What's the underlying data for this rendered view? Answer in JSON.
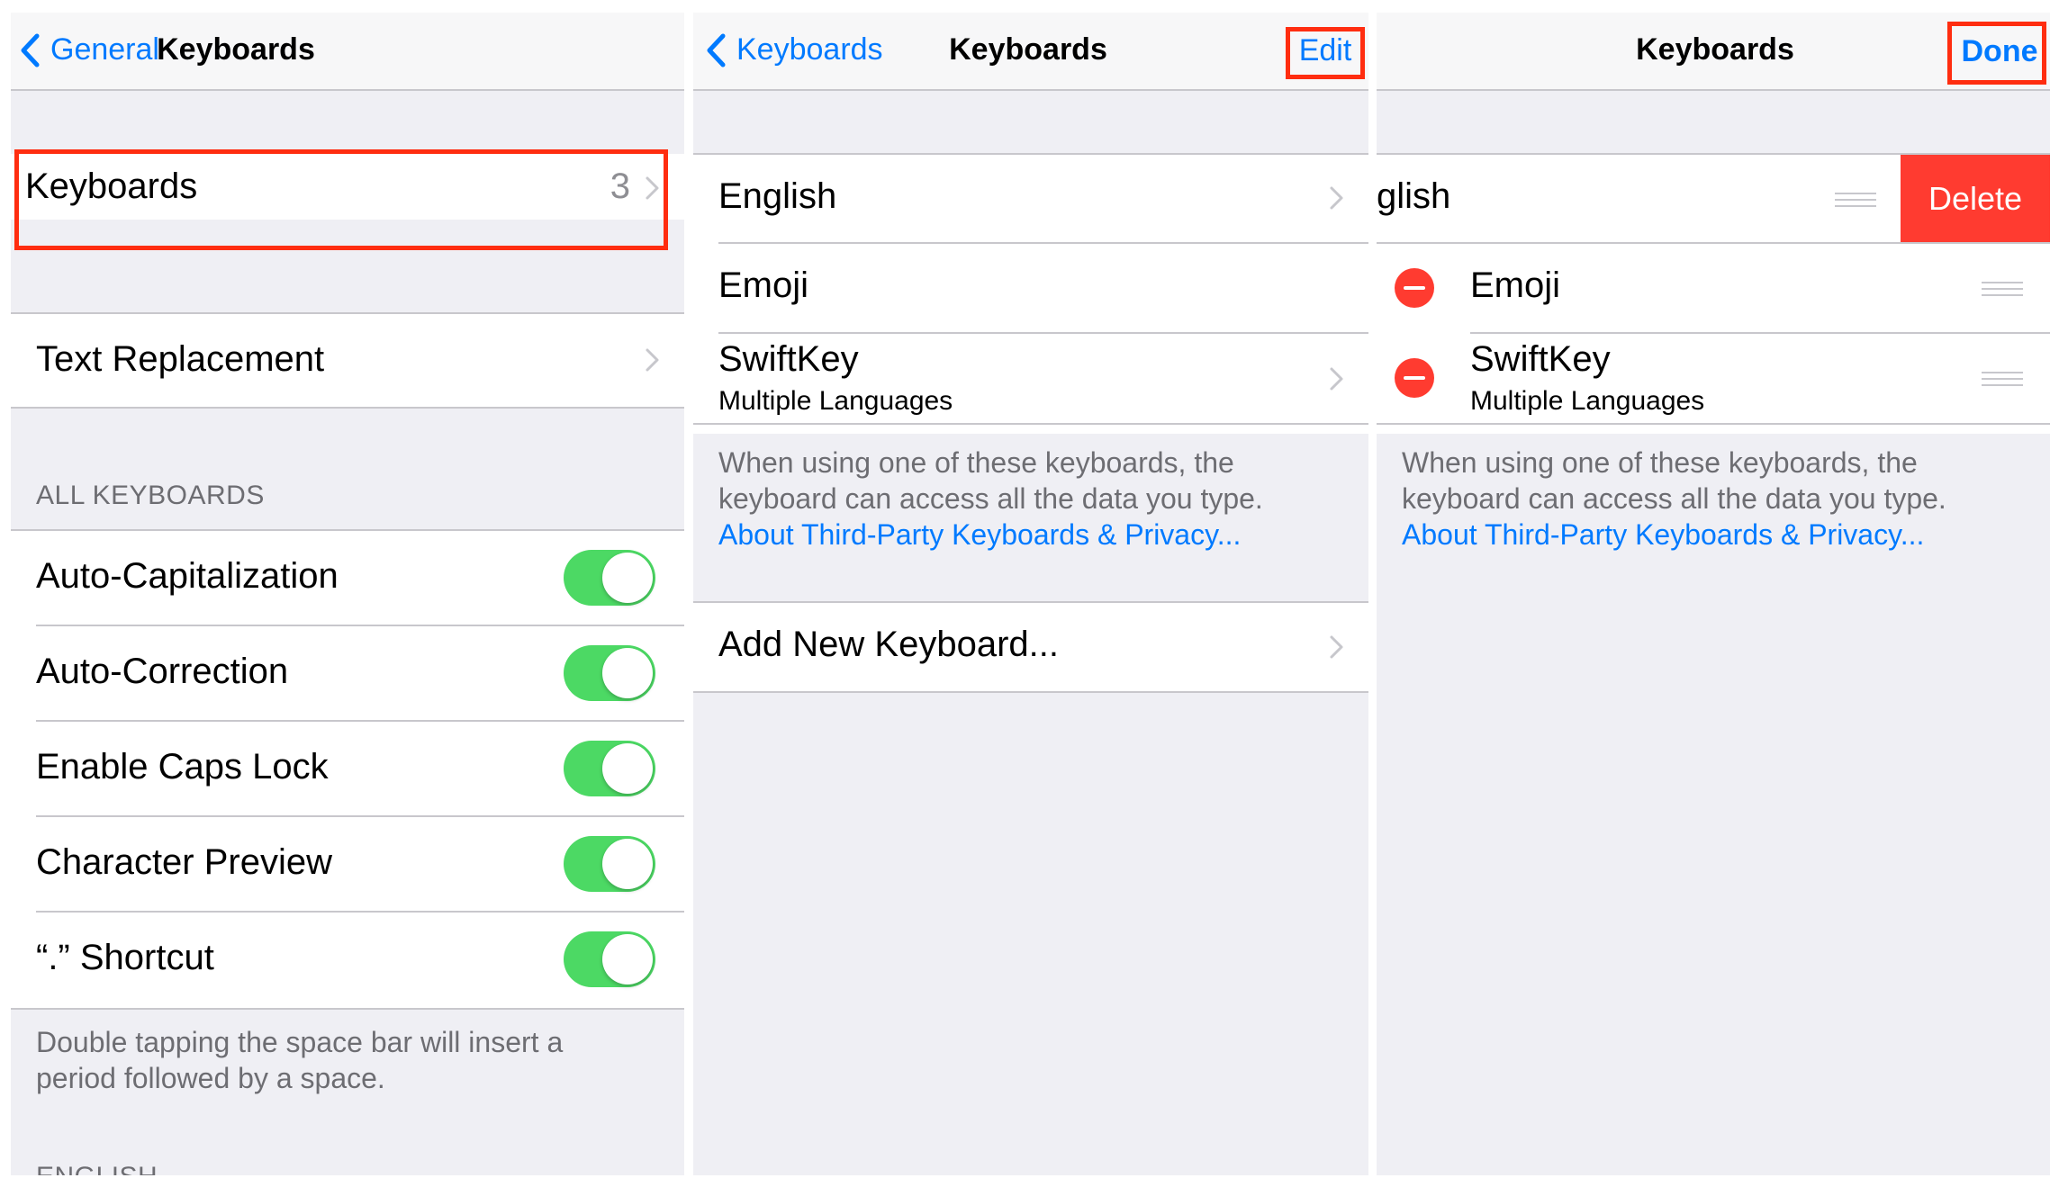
{
  "panel1": {
    "nav": {
      "back": "General",
      "title": "Keyboards"
    },
    "keyboards_row": {
      "label": "Keyboards",
      "value": "3"
    },
    "text_replacement": "Text Replacement",
    "section_header": "ALL KEYBOARDS",
    "toggles": [
      {
        "label": "Auto-Capitalization",
        "on": true
      },
      {
        "label": "Auto-Correction",
        "on": true
      },
      {
        "label": "Enable Caps Lock",
        "on": true
      },
      {
        "label": "Character Preview",
        "on": true
      },
      {
        "label": "“.” Shortcut",
        "on": true
      }
    ],
    "footer": "Double tapping the space bar will insert a period followed by a space.",
    "next_header_partial": "ENGLISH"
  },
  "panel2": {
    "nav": {
      "back": "Keyboards",
      "title": "Keyboards",
      "right": "Edit"
    },
    "rows": [
      {
        "label": "English"
      },
      {
        "label": "Emoji"
      },
      {
        "label": "SwiftKey",
        "sub": "Multiple Languages"
      }
    ],
    "footer_text": "When using one of these keyboards, the keyboard can access all the data you type.",
    "footer_link": "About Third-Party Keyboards & Privacy...",
    "add_row": "Add New Keyboard..."
  },
  "panel3": {
    "nav": {
      "title": "Keyboards",
      "right": "Done"
    },
    "swiped_row": {
      "label": "glish",
      "delete": "Delete"
    },
    "rows": [
      {
        "label": "Emoji"
      },
      {
        "label": "SwiftKey",
        "sub": "Multiple Languages"
      }
    ],
    "footer_text": "When using one of these keyboards, the keyboard can access all the data you type.",
    "footer_link": "About Third-Party Keyboards & Privacy..."
  },
  "colors": {
    "ios_blue": "#007aff",
    "toggle_green": "#4cd964",
    "delete_red": "#ff3b30",
    "highlight_red": "#ff2d10",
    "background": "#efeff4"
  },
  "icons": [
    "chevron-left-icon",
    "chevron-right-icon",
    "minus-circle-icon",
    "reorder-grip-icon"
  ]
}
